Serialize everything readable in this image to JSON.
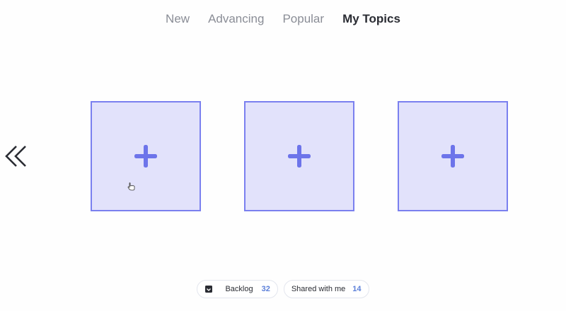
{
  "tabs": [
    {
      "label": "New",
      "active": false
    },
    {
      "label": "Advancing",
      "active": false
    },
    {
      "label": "Popular",
      "active": false
    },
    {
      "label": "My Topics",
      "active": true
    }
  ],
  "navigation": {
    "back_icon": "double-chevron-left-icon"
  },
  "cards": [
    {
      "icon": "plus-icon"
    },
    {
      "icon": "plus-icon"
    },
    {
      "icon": "plus-icon"
    }
  ],
  "footer": {
    "backlog": {
      "label": "Backlog",
      "count": "32",
      "icon": "inbox-icon"
    },
    "shared": {
      "label": "Shared with me",
      "count": "14"
    }
  },
  "colors": {
    "card_fill": "#e2e2fb",
    "card_border": "#7a80ef",
    "active_tab": "#2a2c33",
    "inactive_tab": "#8a8d96",
    "count_accent": "#5b7fd9"
  }
}
